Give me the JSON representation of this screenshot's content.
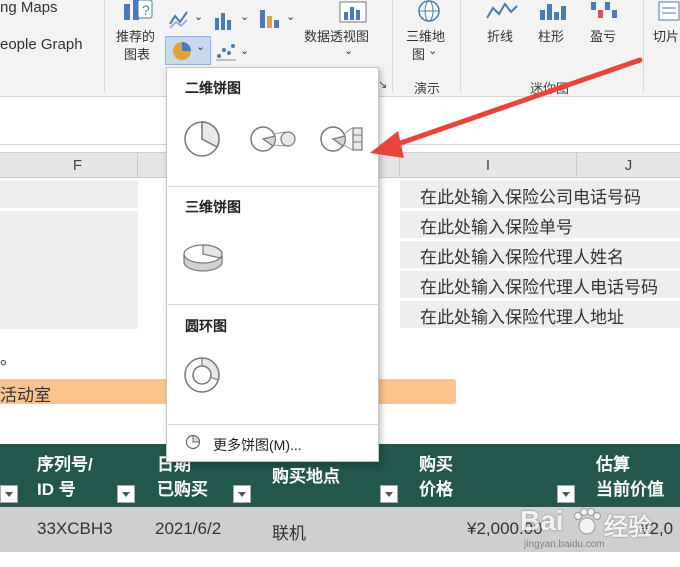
{
  "ribbon": {
    "maps_label": "ng Maps",
    "people_graph_label": "eople Graph",
    "recommended_charts_line1": "推荐的",
    "recommended_charts_line2": "图表",
    "pivot_chart_label": "数据透视图",
    "map_3d_line1": "三维地",
    "map_3d_line2": "图",
    "sparkline_line": "折线",
    "sparkline_column": "柱形",
    "sparkline_winloss": "盈亏",
    "slicer_label": "切片",
    "group_tours": "演示",
    "group_sparklines": "迷你图",
    "dropdown_caret": "⌄",
    "group_launcher": "↘"
  },
  "columns": [
    "F",
    "I",
    "J"
  ],
  "sheet": {
    "info_rows": [
      "在此处输入保险公司电话号码",
      "在此处输入保险单号",
      "在此处输入保险代理人姓名",
      "在此处输入保险代理人电话号码",
      "在此处输入保险代理人地址"
    ],
    "period": "。",
    "orange_cell": "活动室",
    "table_headers": {
      "serial_line1": "序列号/",
      "serial_line2": "ID 号",
      "date_line1": "日期",
      "date_line2": "已购买",
      "place": "购买地点",
      "price_line1": "购买",
      "price_line2": "价格",
      "estimate_line1": "估算",
      "estimate_line2": "当前价值"
    },
    "row": {
      "serial": "33XCBH3",
      "date": "2021/6/2",
      "place": "联机",
      "price": "¥2,000.00",
      "estimate": "¥2,0"
    }
  },
  "dropdown": {
    "section_2d": "二维饼图",
    "section_3d": "三维饼图",
    "section_doughnut": "圆环图",
    "more_label": "更多饼图(M)..."
  },
  "watermark": {
    "brand": "Bai",
    "brand_cn": "经验",
    "url": "jingyan.baidu.com"
  },
  "colors": {
    "table_header": "#23564c",
    "orange_highlight": "#fbc48c",
    "arrow": "#e8443a",
    "icon_blue": "#4a7ab8"
  },
  "icons": [
    "recommended-charts-icon",
    "pie-chart-icon",
    "pivot-chart-icon",
    "3d-map-icon",
    "sparkline-line-icon",
    "sparkline-column-icon",
    "sparkline-winloss-icon",
    "slicer-icon"
  ]
}
